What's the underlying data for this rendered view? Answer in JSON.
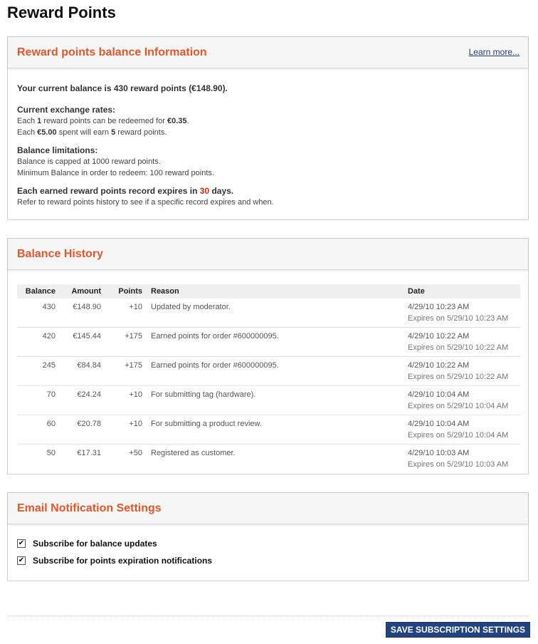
{
  "page": {
    "title": "Reward Points"
  },
  "balance_info": {
    "title": "Reward points balance Information",
    "learn_more": "Learn more...",
    "current": "Your current balance is 430 reward points (€148.90).",
    "rates_head": "Current exchange rates:",
    "rate1": {
      "a": "Each ",
      "b": "1",
      "c": " reward points can be redeemed for ",
      "d": "€0.35",
      "e": "."
    },
    "rate2": {
      "a": "Each ",
      "b": "€5.00",
      "c": " spent will earn ",
      "d": "5",
      "e": " reward points."
    },
    "limits_head": "Balance limitations:",
    "limit1": "Balance is capped at 1000 reward points.",
    "limit2": "Minimum Balance in order to redeem: 100 reward points.",
    "expire_head_a": "Each earned reward points record expires in ",
    "expire_days": "30",
    "expire_head_b": " days.",
    "expire_line": "Refer to reward points history to see if a specific record expires and when."
  },
  "history": {
    "title": "Balance History",
    "columns": {
      "balance": "Balance",
      "amount": "Amount",
      "points": "Points",
      "reason": "Reason",
      "date": "Date"
    },
    "rows": [
      {
        "balance": "430",
        "amount": "€148.90",
        "points": "+10",
        "reason": "Updated by moderator.",
        "date": "4/29/10 10:23 AM",
        "expires": "Expires on 5/29/10 10:23 AM"
      },
      {
        "balance": "420",
        "amount": "€145.44",
        "points": "+175",
        "reason": "Earned points for order #600000095.",
        "date": "4/29/10 10:22 AM",
        "expires": "Expires on 5/29/10 10:22 AM"
      },
      {
        "balance": "245",
        "amount": "€84.84",
        "points": "+175",
        "reason": "Earned points for order #600000095.",
        "date": "4/29/10 10:22 AM",
        "expires": "Expires on 5/29/10 10:22 AM"
      },
      {
        "balance": "70",
        "amount": "€24.24",
        "points": "+10",
        "reason": "For submitting tag (hardware).",
        "date": "4/29/10 10:04 AM",
        "expires": "Expires on 5/29/10 10:04 AM"
      },
      {
        "balance": "60",
        "amount": "€20.78",
        "points": "+10",
        "reason": "For submitting a product review.",
        "date": "4/29/10 10:04 AM",
        "expires": "Expires on 5/29/10 10:04 AM"
      },
      {
        "balance": "50",
        "amount": "€17.31",
        "points": "+50",
        "reason": "Registered as customer.",
        "date": "4/29/10 10:03 AM",
        "expires": "Expires on 5/29/10 10:03 AM"
      }
    ]
  },
  "email": {
    "title": "Email Notification Settings",
    "options": [
      {
        "label": "Subscribe for balance updates",
        "checked": true
      },
      {
        "label": "Subscribe for points expiration notifications",
        "checked": true
      }
    ]
  },
  "actions": {
    "save_label": "Save Subscription Settings"
  },
  "colors": {
    "accent": "#e2562a",
    "button": "#21437f",
    "link": "#1e3f86",
    "highlight": "#d22b0e"
  }
}
